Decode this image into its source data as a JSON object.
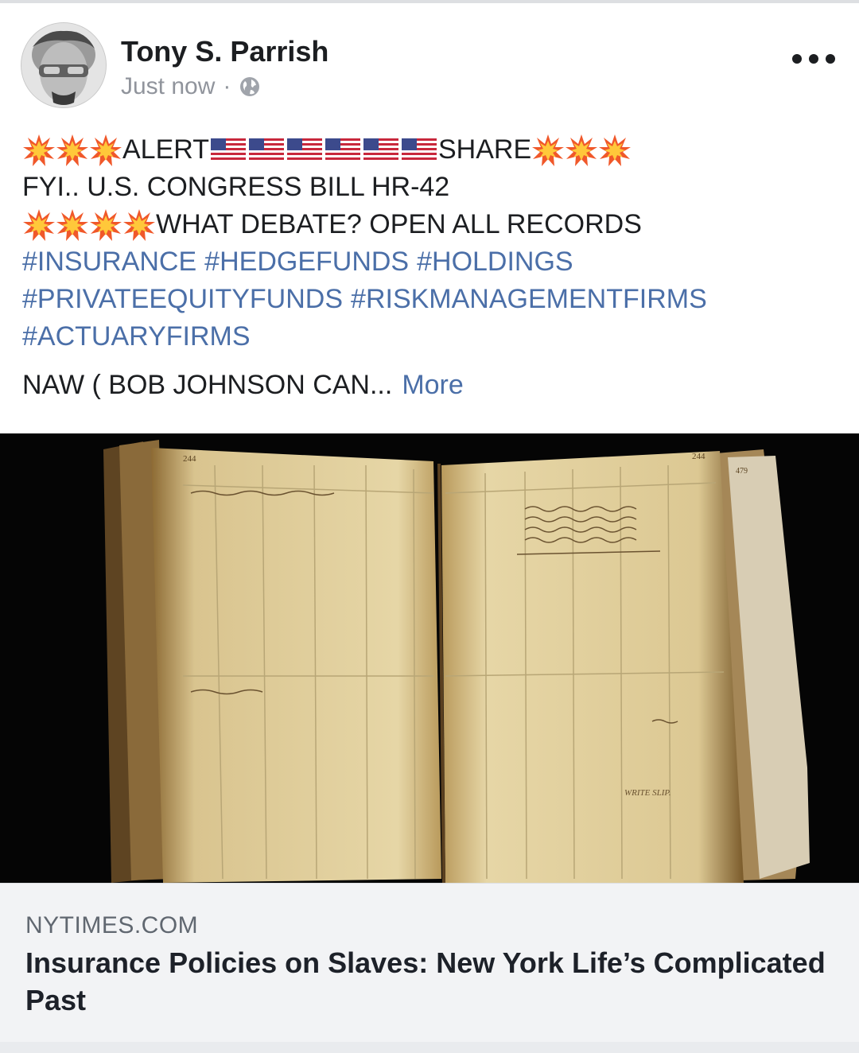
{
  "post": {
    "author_name": "Tony S. Parrish",
    "timestamp": "Just now",
    "separator": "·",
    "privacy_icon": "globe-icon",
    "menu_icon": "more-options-icon",
    "alert_label": "ALERT",
    "share_label": "SHARE",
    "line2": "FYI.. U.S. CONGRESS BILL HR-42",
    "line3": "WHAT DEBATE? OPEN ALL RECORDS",
    "hashtags": [
      "#INSURANCE",
      "#HEDGEFUNDS",
      "#HOLDINGS",
      "#PRIVATEEQUITYFUNDS",
      "#RISKMANAGEMENTFIRMS",
      "#ACTUARYFIRMS"
    ],
    "truncated_text": "NAW ( BOB JOHNSON CAN...",
    "more_label": "More",
    "emoji": {
      "boom": "collision-emoji",
      "flag": "us-flag-emoji"
    }
  },
  "link_preview": {
    "domain": "NYTIMES.COM",
    "title": "Insurance Policies on Slaves: New York Life’s Complicated Past",
    "image_text": {
      "page_number_left": "244",
      "page_number_right": "244",
      "tab_number": "479",
      "stamp": "WRITE SLIP."
    }
  },
  "colors": {
    "link_blue": "#4b6fa8",
    "meta_gray": "#90949c",
    "preview_bg": "#f2f3f5"
  }
}
